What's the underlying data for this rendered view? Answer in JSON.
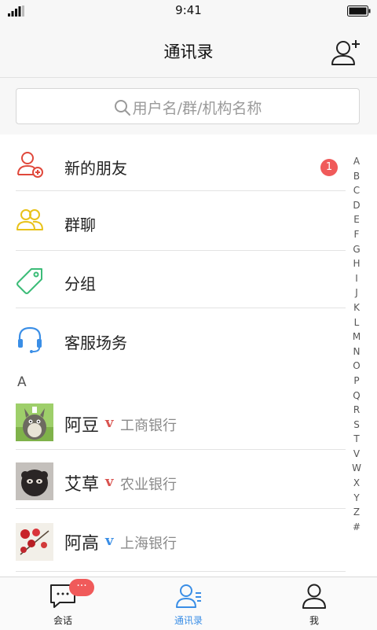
{
  "status_bar": {
    "time": "9:41"
  },
  "nav": {
    "title": "通讯录"
  },
  "search": {
    "placeholder": "用户名/群/机构名称"
  },
  "menu": [
    {
      "label": "新的朋友",
      "badge": "1",
      "icon": "add-friend-icon",
      "color": "#e0483b"
    },
    {
      "label": "群聊",
      "icon": "group-chat-icon",
      "color": "#e8c21a"
    },
    {
      "label": "分组",
      "icon": "tag-icon",
      "color": "#3cbc78"
    },
    {
      "label": "客服场务",
      "icon": "headset-icon",
      "color": "#3a8ee6"
    }
  ],
  "section_label": "A",
  "contacts": [
    {
      "name": "阿豆",
      "mark": "v",
      "mark_color": "#d9534f",
      "org": "工商银行"
    },
    {
      "name": "艾草",
      "mark": "v",
      "mark_color": "#d9534f",
      "org": "农业银行"
    },
    {
      "name": "阿高",
      "mark": "v",
      "mark_color": "#3a8ee6",
      "org": "上海银行"
    }
  ],
  "index_letters": [
    "A",
    "B",
    "C",
    "D",
    "E",
    "F",
    "G",
    "H",
    "I",
    "J",
    "K",
    "L",
    "M",
    "N",
    "O",
    "P",
    "Q",
    "R",
    "S",
    "T",
    "V",
    "W",
    "X",
    "Y",
    "Z",
    "#"
  ],
  "tabs": [
    {
      "label": "会话",
      "icon": "chat-icon",
      "badge": "···"
    },
    {
      "label": "通讯录",
      "icon": "contacts-icon",
      "active": true
    },
    {
      "label": "我",
      "icon": "profile-icon"
    }
  ],
  "colors": {
    "accent": "#3a8ee6",
    "badge": "#f05a5a"
  }
}
